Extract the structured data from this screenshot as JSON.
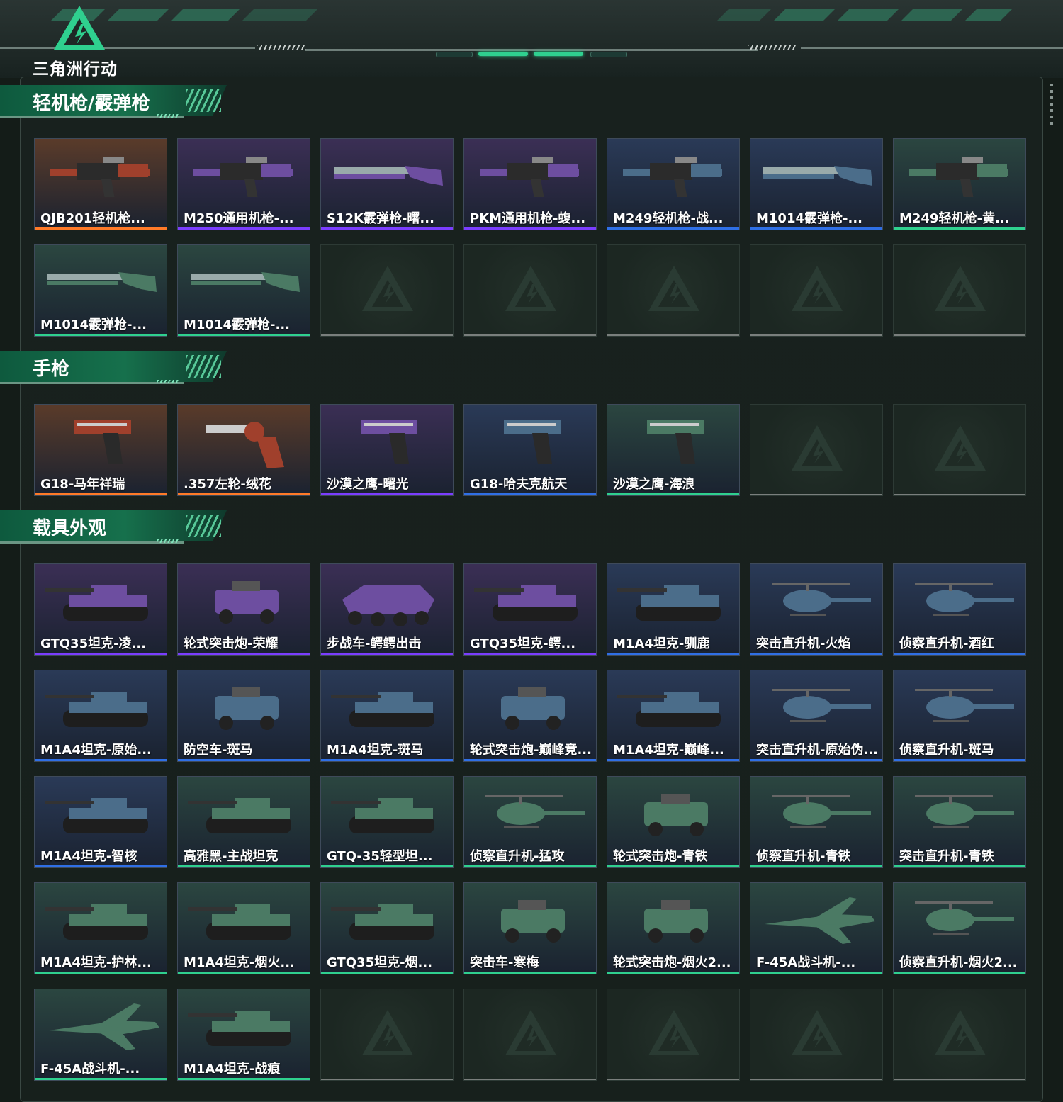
{
  "app": {
    "logo_text": "三角洲行动",
    "logo_color": "#2fd08f"
  },
  "rarity_colors": {
    "orange": [
      "#5a3b2a",
      "#ff7a28"
    ],
    "purple": [
      "#3b2f55",
      "#7b3dff"
    ],
    "blue": [
      "#2a3a57",
      "#2f6fe6"
    ],
    "green": [
      "#2b4640",
      "#2fd08f"
    ],
    "empty": [
      "#1f2a25",
      "#7a7f7d"
    ]
  },
  "sections": [
    {
      "title": "轻机枪/霰弹枪",
      "items": [
        {
          "label": "QJB201轻机枪...",
          "rarity": "orange",
          "icon": "machine-gun-icon"
        },
        {
          "label": "M250通用机枪-...",
          "rarity": "purple",
          "icon": "machine-gun-icon"
        },
        {
          "label": "S12K霰弹枪-曙...",
          "rarity": "purple",
          "icon": "shotgun-icon"
        },
        {
          "label": "PKM通用机枪-蝮...",
          "rarity": "purple",
          "icon": "machine-gun-icon"
        },
        {
          "label": "M249轻机枪-战...",
          "rarity": "blue",
          "icon": "machine-gun-icon"
        },
        {
          "label": "M1014霰弹枪-...",
          "rarity": "blue",
          "icon": "shotgun-icon"
        },
        {
          "label": "M249轻机枪-黄...",
          "rarity": "green",
          "icon": "machine-gun-icon"
        },
        {
          "label": "M1014霰弹枪-...",
          "rarity": "green",
          "icon": "shotgun-icon"
        },
        {
          "label": "M1014霰弹枪-...",
          "rarity": "green",
          "icon": "shotgun-icon"
        },
        {
          "label": "",
          "rarity": "empty",
          "icon": "placeholder-icon"
        },
        {
          "label": "",
          "rarity": "empty",
          "icon": "placeholder-icon"
        },
        {
          "label": "",
          "rarity": "empty",
          "icon": "placeholder-icon"
        },
        {
          "label": "",
          "rarity": "empty",
          "icon": "placeholder-icon"
        },
        {
          "label": "",
          "rarity": "empty",
          "icon": "placeholder-icon"
        }
      ]
    },
    {
      "title": "手枪",
      "items": [
        {
          "label": "G18-马年祥瑞",
          "rarity": "orange",
          "icon": "pistol-icon"
        },
        {
          "label": ".357左轮-绒花",
          "rarity": "orange",
          "icon": "revolver-icon"
        },
        {
          "label": "沙漠之鹰-曙光",
          "rarity": "purple",
          "icon": "pistol-icon"
        },
        {
          "label": "G18-哈夫克航天",
          "rarity": "blue",
          "icon": "pistol-icon"
        },
        {
          "label": "沙漠之鹰-海浪",
          "rarity": "green",
          "icon": "pistol-icon"
        },
        {
          "label": "",
          "rarity": "empty",
          "icon": "placeholder-icon"
        },
        {
          "label": "",
          "rarity": "empty",
          "icon": "placeholder-icon"
        }
      ]
    },
    {
      "title": "载具外观",
      "items": [
        {
          "label": "GTQ35坦克-凌...",
          "rarity": "purple",
          "icon": "tank-icon"
        },
        {
          "label": "轮式突击炮-荣耀",
          "rarity": "purple",
          "icon": "armored-car-icon"
        },
        {
          "label": "步战车-鳄鳄出击",
          "rarity": "purple",
          "icon": "ifv-icon"
        },
        {
          "label": "GTQ35坦克-鳄...",
          "rarity": "purple",
          "icon": "tank-icon"
        },
        {
          "label": "M1A4坦克-驯鹿",
          "rarity": "blue",
          "icon": "tank-icon"
        },
        {
          "label": "突击直升机-火焰",
          "rarity": "blue",
          "icon": "helicopter-icon"
        },
        {
          "label": "侦察直升机-酒红",
          "rarity": "blue",
          "icon": "helicopter-icon"
        },
        {
          "label": "M1A4坦克-原始...",
          "rarity": "blue",
          "icon": "tank-icon"
        },
        {
          "label": "防空车-斑马",
          "rarity": "blue",
          "icon": "armored-car-icon"
        },
        {
          "label": "M1A4坦克-斑马",
          "rarity": "blue",
          "icon": "tank-icon"
        },
        {
          "label": "轮式突击炮-巅峰竞...",
          "rarity": "blue",
          "icon": "armored-car-icon"
        },
        {
          "label": "M1A4坦克-巅峰...",
          "rarity": "blue",
          "icon": "tank-icon"
        },
        {
          "label": "突击直升机-原始伪...",
          "rarity": "blue",
          "icon": "helicopter-icon"
        },
        {
          "label": "侦察直升机-斑马",
          "rarity": "blue",
          "icon": "helicopter-icon"
        },
        {
          "label": "M1A4坦克-智核",
          "rarity": "blue",
          "icon": "tank-icon"
        },
        {
          "label": "高雅黑-主战坦克",
          "rarity": "green",
          "icon": "tank-icon"
        },
        {
          "label": "GTQ-35轻型坦...",
          "rarity": "green",
          "icon": "tank-icon"
        },
        {
          "label": "侦察直升机-猛攻",
          "rarity": "green",
          "icon": "helicopter-icon"
        },
        {
          "label": "轮式突击炮-青铁",
          "rarity": "green",
          "icon": "armored-car-icon"
        },
        {
          "label": "侦察直升机-青铁",
          "rarity": "green",
          "icon": "helicopter-icon"
        },
        {
          "label": "突击直升机-青铁",
          "rarity": "green",
          "icon": "helicopter-icon"
        },
        {
          "label": "M1A4坦克-护林...",
          "rarity": "green",
          "icon": "tank-icon"
        },
        {
          "label": "M1A4坦克-烟火...",
          "rarity": "green",
          "icon": "tank-icon"
        },
        {
          "label": "GTQ35坦克-烟...",
          "rarity": "green",
          "icon": "tank-icon"
        },
        {
          "label": "突击车-寒梅",
          "rarity": "green",
          "icon": "armored-car-icon"
        },
        {
          "label": "轮式突击炮-烟火2...",
          "rarity": "green",
          "icon": "armored-car-icon"
        },
        {
          "label": "F-45A战斗机-...",
          "rarity": "green",
          "icon": "jet-icon"
        },
        {
          "label": "侦察直升机-烟火2...",
          "rarity": "green",
          "icon": "helicopter-icon"
        },
        {
          "label": "F-45A战斗机-...",
          "rarity": "green",
          "icon": "jet-icon"
        },
        {
          "label": "M1A4坦克-战痕",
          "rarity": "green",
          "icon": "tank-icon"
        },
        {
          "label": "",
          "rarity": "empty",
          "icon": "placeholder-icon"
        },
        {
          "label": "",
          "rarity": "empty",
          "icon": "placeholder-icon"
        },
        {
          "label": "",
          "rarity": "empty",
          "icon": "placeholder-icon"
        },
        {
          "label": "",
          "rarity": "empty",
          "icon": "placeholder-icon"
        },
        {
          "label": "",
          "rarity": "empty",
          "icon": "placeholder-icon"
        }
      ]
    }
  ]
}
